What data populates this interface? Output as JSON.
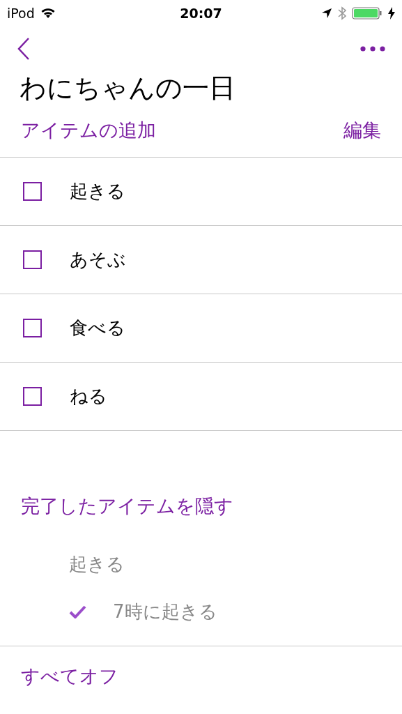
{
  "status_bar": {
    "carrier": "iPod",
    "time": "20:07"
  },
  "title": "わにちゃんの一日",
  "toolbar": {
    "add": "アイテムの追加",
    "edit": "編集"
  },
  "items": [
    {
      "label": "起きる",
      "checked": false
    },
    {
      "label": "あそぶ",
      "checked": false
    },
    {
      "label": "食べる",
      "checked": false
    },
    {
      "label": "ねる",
      "checked": false
    }
  ],
  "completed": {
    "toggle": "完了したアイテムを隠す",
    "items": [
      {
        "kind": "heading",
        "label": "起きる"
      },
      {
        "kind": "item",
        "label": "7時に起きる",
        "checked": true
      }
    ]
  },
  "footer": "すべてオフ"
}
